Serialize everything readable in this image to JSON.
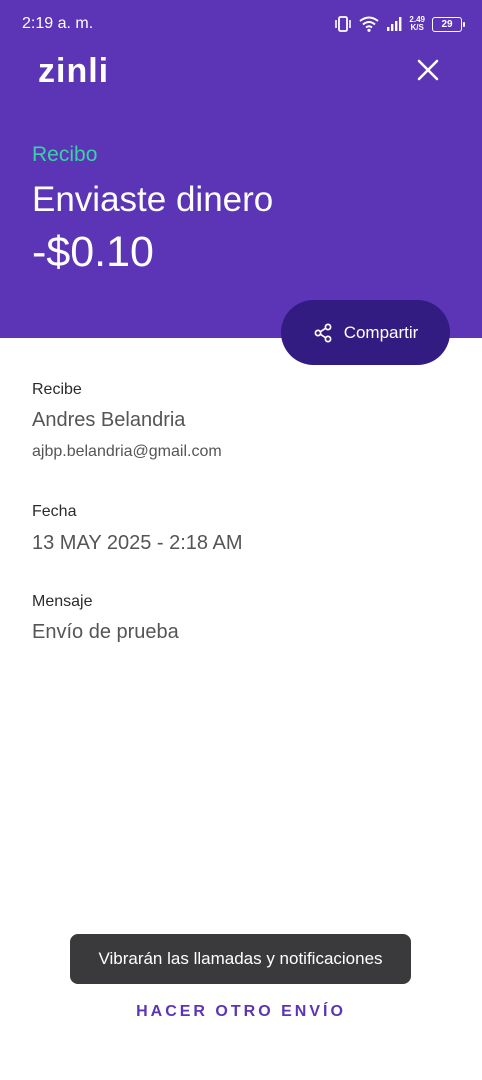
{
  "status_bar": {
    "time": "2:19 a. m.",
    "net_speed_value": "2.49",
    "net_speed_unit": "K/S",
    "battery": "29",
    "icons": [
      "vibrate-icon",
      "wifi-icon",
      "signal-icon",
      "battery-icon"
    ]
  },
  "header": {
    "logo": "zinli",
    "close_icon": "close-icon",
    "receipt_label": "Recibo",
    "title": "Enviaste dinero",
    "amount": "-$0.10",
    "share_label": "Compartir",
    "share_icon": "share-icon"
  },
  "details": {
    "recipient_label": "Recibe",
    "recipient_name": "Andres Belandria",
    "recipient_email": "ajbp.belandria@gmail.com",
    "date_label": "Fecha",
    "date_value": "13 MAY 2025 - 2:18 AM",
    "message_label": "Mensaje",
    "message_value": "Envío de prueba"
  },
  "toast": {
    "text": "Vibrarán las llamadas y notificaciones"
  },
  "footer": {
    "action_label": "HACER OTRO ENVÍO"
  },
  "colors": {
    "header_bg": "#5b35b5",
    "accent_teal": "#3ccfa9",
    "share_button_bg": "#321c82",
    "toast_bg": "#3a3a3c"
  }
}
